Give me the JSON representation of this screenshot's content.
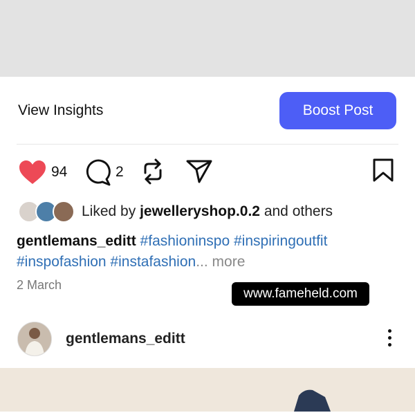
{
  "actions": {
    "view_insights_label": "View Insights",
    "boost_post_label": "Boost Post",
    "boost_color": "#4d5ef6"
  },
  "counts": {
    "likes": "94",
    "comments": "2"
  },
  "icons": {
    "like": "heart-filled-icon",
    "comment": "comment-icon",
    "repost": "repost-icon",
    "share": "send-icon",
    "save": "bookmark-icon",
    "like_color": "#ed4956"
  },
  "liked_by": {
    "prefix": "Liked by ",
    "user": "jewelleryshop.0.2",
    "suffix": " and others"
  },
  "caption": {
    "username": "gentlemans_editt",
    "hashtags_line1": " #fashioninspo #inspiringoutfit",
    "hashtags_line2": "#inspofashion #instafashion",
    "more": "... more"
  },
  "post_date": "2 March",
  "watermark": "www.fameheld.com",
  "next_post": {
    "username": "gentlemans_editt"
  }
}
